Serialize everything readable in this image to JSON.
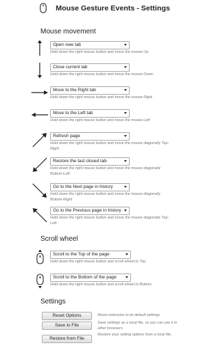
{
  "header": {
    "title": "Mouse Gesture Events - Settings",
    "logo_icon": "mouse-icon"
  },
  "sections": {
    "movement": "Mouse movement",
    "wheel": "Scroll wheel",
    "settings": "Settings"
  },
  "gestures": [
    {
      "arrow": "arrow-up-icon",
      "action": "Open new tab",
      "desc": "Hold down the right mouse button and move the mouse Up"
    },
    {
      "arrow": "arrow-down-icon",
      "action": "Close current tab",
      "desc": "Hold down the right mouse button and move the mouse Down"
    },
    {
      "arrow": "arrow-right-icon",
      "action": "Move to the Right tab",
      "desc": "Hold down the right mouse button and move the mouse Right"
    },
    {
      "arrow": "arrow-left-icon",
      "action": "Move to the Left tab",
      "desc": "Hold down the right mouse button and move the mouse Left"
    },
    {
      "arrow": "arrow-up-right-icon",
      "action": "Refresh page",
      "desc": "Hold down the right mouse button and move the mouse diagonally Top-Right"
    },
    {
      "arrow": "arrow-down-left-icon",
      "action": "Restore the last closed tab",
      "desc": "Hold down the right mouse button and move the mouse diagonally Bottom-Left"
    },
    {
      "arrow": "arrow-down-right-icon",
      "action": "Go to the Next page in history",
      "desc": "Hold down the right mouse button and move the mouse diagonally Bottom-Right"
    },
    {
      "arrow": "arrow-up-left-icon",
      "action": "Go to the Previous page in history",
      "desc": "Hold down the right mouse button and move the mouse diagonally Top-Left"
    }
  ],
  "wheel": [
    {
      "icon": "scroll-up-icon",
      "action": "Scroll to the Top of the page",
      "desc": "Hold down the right mouse button and scroll wheel to Top"
    },
    {
      "icon": "scroll-down-icon",
      "action": "Scroll to the Bottom of the page",
      "desc": "Hold down the right mouse button and scroll wheel to Bottom"
    }
  ],
  "settings": [
    {
      "label": "Reset Options",
      "desc": "Reset extension to its default settings."
    },
    {
      "label": "Save to File",
      "desc": "Save settings as a local file, so you can use it in other browsers."
    },
    {
      "label": "Restore from File",
      "desc": "Restore your setting options from a local file."
    }
  ]
}
